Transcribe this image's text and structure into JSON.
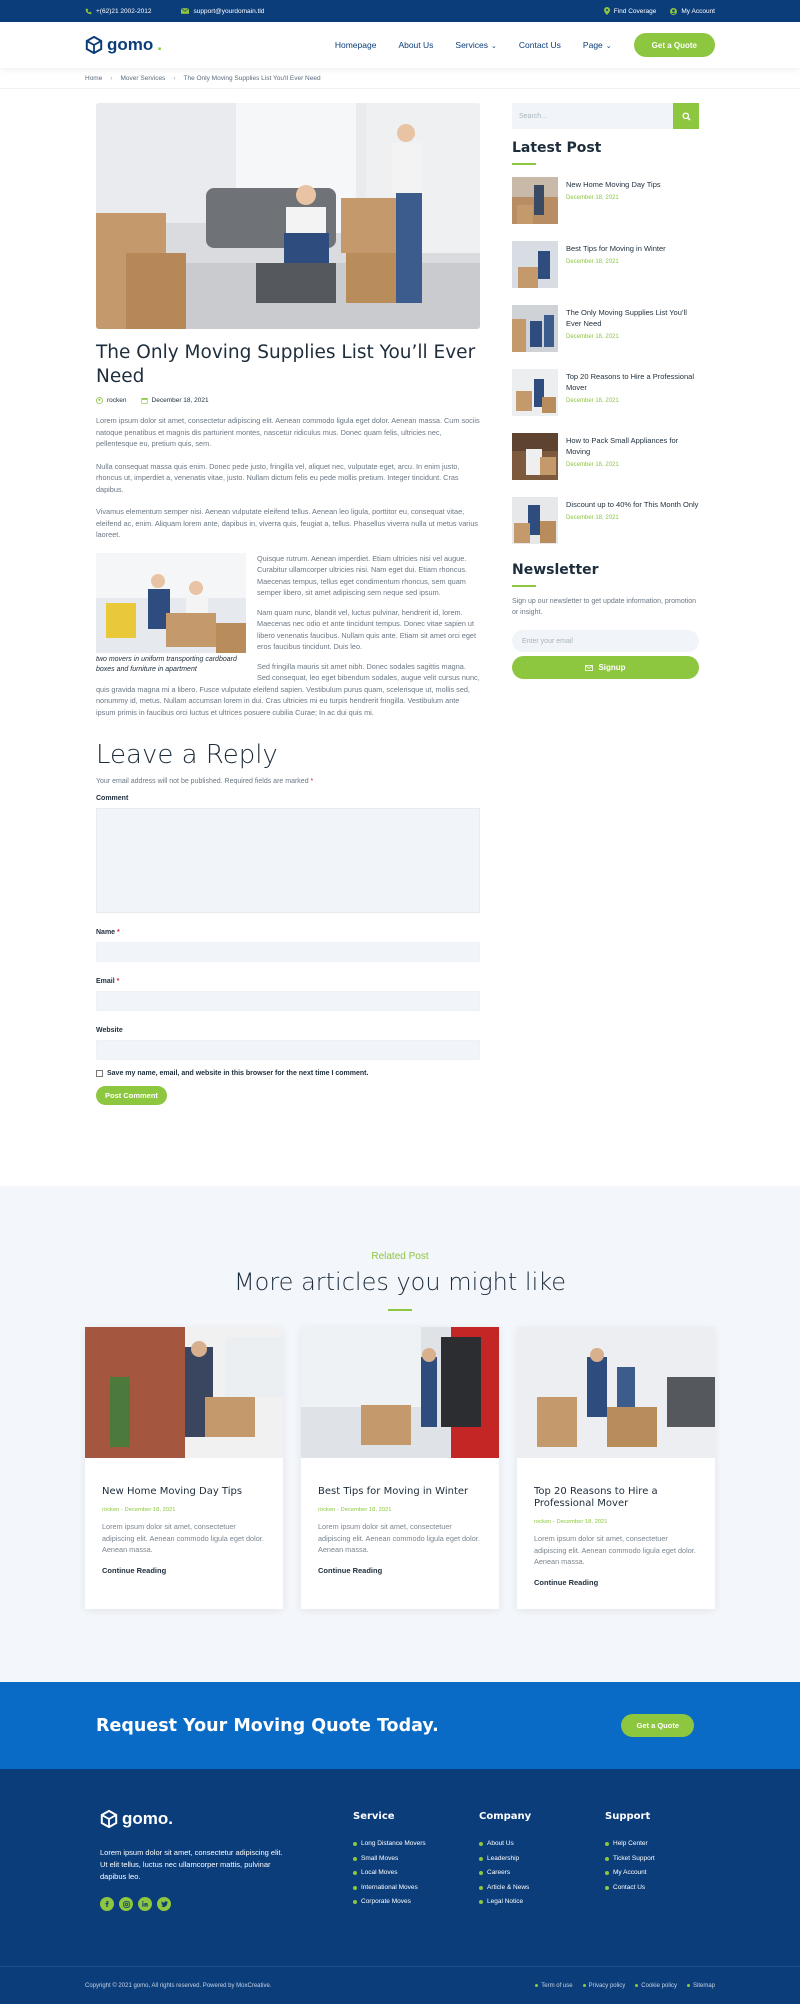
{
  "topbar": {
    "phone": "+(62)21 2002-2012",
    "email": "support@yourdomain.tld",
    "find_coverage": "Find Coverage",
    "my_account": "My Account"
  },
  "header": {
    "logo": "gomo",
    "logo_dot": ".",
    "nav": [
      "Homepage",
      "About Us",
      "Services",
      "Contact Us",
      "Page"
    ],
    "cta": "Get a Quote"
  },
  "breadcrumb": [
    "Home",
    "Mover Services",
    "The Only Moving Supplies List You'll Ever Need"
  ],
  "post": {
    "title": "The Only Moving Supplies List You’ll Ever Need",
    "author": "rocken",
    "date": "December 18, 2021",
    "paragraphs": [
      "Lorem ipsum dolor sit amet, consectetur adipiscing elit. Aenean commodo ligula eget dolor. Aenean massa. Cum sociis natoque penatibus et magnis dis parturient montes, nascetur ridiculus mus. Donec quam felis, ultricies nec, pellentesque eu, pretium quis, sem.",
      "Nulla consequat massa quis enim. Donec pede justo, fringilla vel, aliquet nec, vulputate eget, arcu. In enim justo, rhoncus ut, imperdiet a, venenatis vitae, justo. Nullam dictum felis eu pede mollis pretium. Integer tincidunt. Cras dapibus.",
      "Vivamus elementum semper nisi. Aenean vulputate eleifend tellus. Aenean leo ligula, porttitor eu, consequat vitae, eleifend ac, enim. Aliquam lorem ante, dapibus in, viverra quis, feugiat a, tellus. Phasellus viverra nulla ut metus varius laoreet."
    ],
    "caption": "two movers in uniform transporting cardboard boxes and furniture in apartment",
    "float_paragraphs": [
      "Quisque rutrum. Aenean imperdiet. Etiam ultricies nisi vel augue. Curabitur ullamcorper ultricies nisi. Nam eget dui. Etiam rhoncus. Maecenas tempus, tellus eget condimentum rhoncus, sem quam semper libero, sit amet adipiscing sem neque sed ipsum.",
      "Nam quam nunc, blandit vel, luctus pulvinar, hendrerit id, lorem. Maecenas nec odio et ante tincidunt tempus. Donec vitae sapien ut libero venenatis faucibus. Nullam quis ante. Etiam sit amet orci eget eros faucibus tincidunt. Duis leo.",
      "Sed fringilla mauris sit amet nibh. Donec sodales sagittis magna. Sed consequat, leo eget bibendum sodales, augue velit cursus nunc, quis gravida magna mi a libero. Fusce vulputate eleifend sapien. Vestibulum purus quam, scelerisque ut, mollis sed, nonummy id, metus. Nullam accumsan lorem in dui. Cras ultricies mi eu turpis hendrerit fringilla. Vestibulum ante ipsum primis in faucibus orci luctus et ultrices posuere cubilia Curae; In ac dui quis mi."
    ]
  },
  "reply": {
    "title": "Leave a Reply",
    "note": "Your email address will not be published. Required fields are marked",
    "req": "*",
    "comment_label": "Comment",
    "name_label": "Name",
    "email_label": "Email",
    "website_label": "Website",
    "save_label": "Save my name, email, and website in this browser for the next time I comment.",
    "submit": "Post Comment"
  },
  "sidebar": {
    "search_placeholder": "Search...",
    "latest_title": "Latest Post",
    "posts": [
      {
        "title": "New Home Moving Day Tips",
        "date": "December 18, 2021"
      },
      {
        "title": "Best Tips for Moving in Winter",
        "date": "December 18, 2021"
      },
      {
        "title": "The Only Moving Supplies List You’ll Ever Need",
        "date": "December 18, 2021"
      },
      {
        "title": "Top 20 Reasons to Hire a Professional Mover",
        "date": "December 18, 2021"
      },
      {
        "title": "How to Pack Small Appliances for Moving",
        "date": "December 18, 2021"
      },
      {
        "title": "Discount up to 40% for This Month Only",
        "date": "December 18, 2021"
      }
    ],
    "newsletter_title": "Newsletter",
    "newsletter_text": "Sign up our newsletter to get update information, promotion or insight.",
    "email_placeholder": "Enter your email",
    "signup": "Signup"
  },
  "related": {
    "subtitle": "Related Post",
    "title": "More articles you might like",
    "cards": [
      {
        "title": "New Home Moving Day Tips",
        "meta": "rocken - December 18, 2021",
        "text": "Lorem ipsum dolor sit amet, consectetuer adipiscing elit. Aenean commodo ligula eget dolor. Aenean massa.",
        "more": "Continue Reading"
      },
      {
        "title": "Best Tips for Moving in Winter",
        "meta": "rocken - December 18, 2021",
        "text": "Lorem ipsum dolor sit amet, consectetuer adipiscing elit. Aenean commodo ligula eget dolor. Aenean massa.",
        "more": "Continue Reading"
      },
      {
        "title": "Top 20 Reasons to Hire a Professional Mover",
        "meta": "rocken - December 18, 2021",
        "text": "Lorem ipsum dolor sit amet, consectetuer adipiscing elit. Aenean commodo ligula eget dolor. Aenean massa.",
        "more": "Continue Reading"
      }
    ]
  },
  "cta": {
    "title": "Request Your Moving Quote Today.",
    "button": "Get a Quote"
  },
  "footer": {
    "logo": "gomo.",
    "about": "Lorem ipsum dolor sit amet, consectetur adipiscing elit. Ut elit tellus, luctus nec ullamcorper mattis, pulvinar dapibus leo.",
    "service_title": "Service",
    "service": [
      "Long Distance Movers",
      "Small Moves",
      "Local Moves",
      "International Moves",
      "Corporate Moves"
    ],
    "company_title": "Company",
    "company": [
      "About Us",
      "Leadership",
      "Careers",
      "Article & News",
      "Legal Notice"
    ],
    "support_title": "Support",
    "support": [
      "Help Center",
      "Ticket Support",
      "My Account",
      "Contact Us"
    ],
    "copyright": "Copyright © 2021 gomo, All rights reserved. Powered by MoxCreative.",
    "links": [
      "Term of use",
      "Privacy policy",
      "Cookie policy",
      "Sitemap"
    ]
  },
  "colors": {
    "navy": "#0b3d7a",
    "green": "#8dc63f",
    "blue": "#0a6bc6"
  }
}
